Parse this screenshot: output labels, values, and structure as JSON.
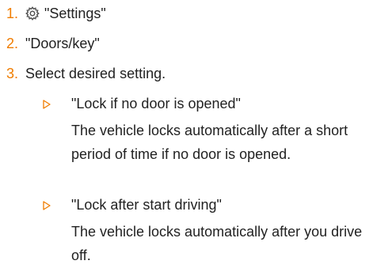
{
  "colors": {
    "accent": "#f07d00",
    "text": "#222222"
  },
  "steps": [
    {
      "number": "1.",
      "icon": "gear-icon",
      "text": "\"Settings\""
    },
    {
      "number": "2.",
      "text": "\"Doors/key\""
    },
    {
      "number": "3.",
      "text": "Select desired setting."
    }
  ],
  "options": [
    {
      "marker": "triangle-bullet-icon",
      "title": "\"Lock if no door is opened\"",
      "description": "The vehicle locks automatically after a short period of time if no door is opened."
    },
    {
      "marker": "triangle-bullet-icon",
      "title": "\"Lock after start driving\"",
      "description": "The vehicle locks automatically after you drive off."
    }
  ]
}
